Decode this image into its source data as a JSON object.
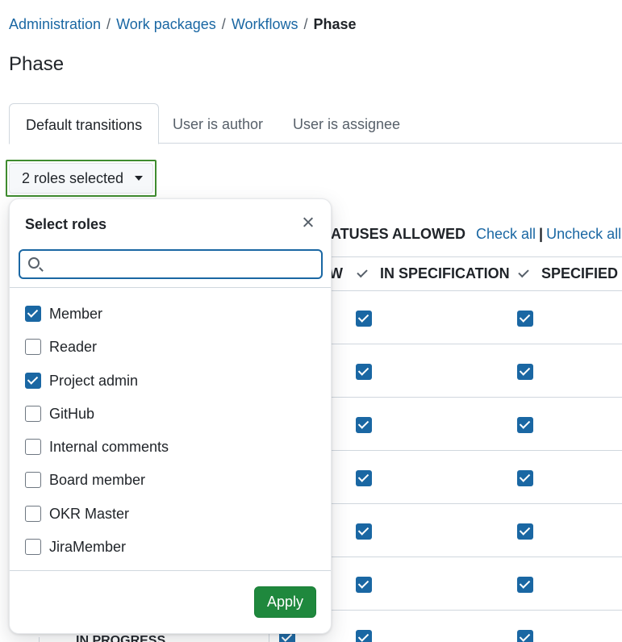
{
  "breadcrumb": {
    "items": [
      "Administration",
      "Work packages",
      "Workflows"
    ],
    "separator": "/",
    "current": "Phase"
  },
  "page_title": "Phase",
  "tabs": [
    {
      "label": "Default transitions",
      "active": true
    },
    {
      "label": "User is author",
      "active": false
    },
    {
      "label": "User is assignee",
      "active": false
    }
  ],
  "roles_button": {
    "label": "2 roles selected"
  },
  "statuses_header": {
    "title": "ATUSES ALLOWED",
    "check_all": "Check all",
    "separator": "|",
    "uncheck_all": "Uncheck all"
  },
  "table": {
    "columns": [
      "W",
      "IN SPECIFICATION",
      "SPECIFIED"
    ],
    "visible_row_label": "IN PROGRESS"
  },
  "popover": {
    "title": "Select roles",
    "search": {
      "value": "",
      "placeholder": ""
    },
    "roles": [
      {
        "label": "Member",
        "checked": true
      },
      {
        "label": "Reader",
        "checked": false
      },
      {
        "label": "Project admin",
        "checked": true
      },
      {
        "label": "GitHub",
        "checked": false
      },
      {
        "label": "Internal comments",
        "checked": false
      },
      {
        "label": "Board member",
        "checked": false
      },
      {
        "label": "OKR Master",
        "checked": false
      },
      {
        "label": "JiraMember",
        "checked": false
      }
    ],
    "apply_label": "Apply"
  },
  "colors": {
    "link": "#1a67a3",
    "checkbox": "#1a67a3",
    "apply": "#1f883d",
    "focus_outline": "#3f8c2f"
  }
}
